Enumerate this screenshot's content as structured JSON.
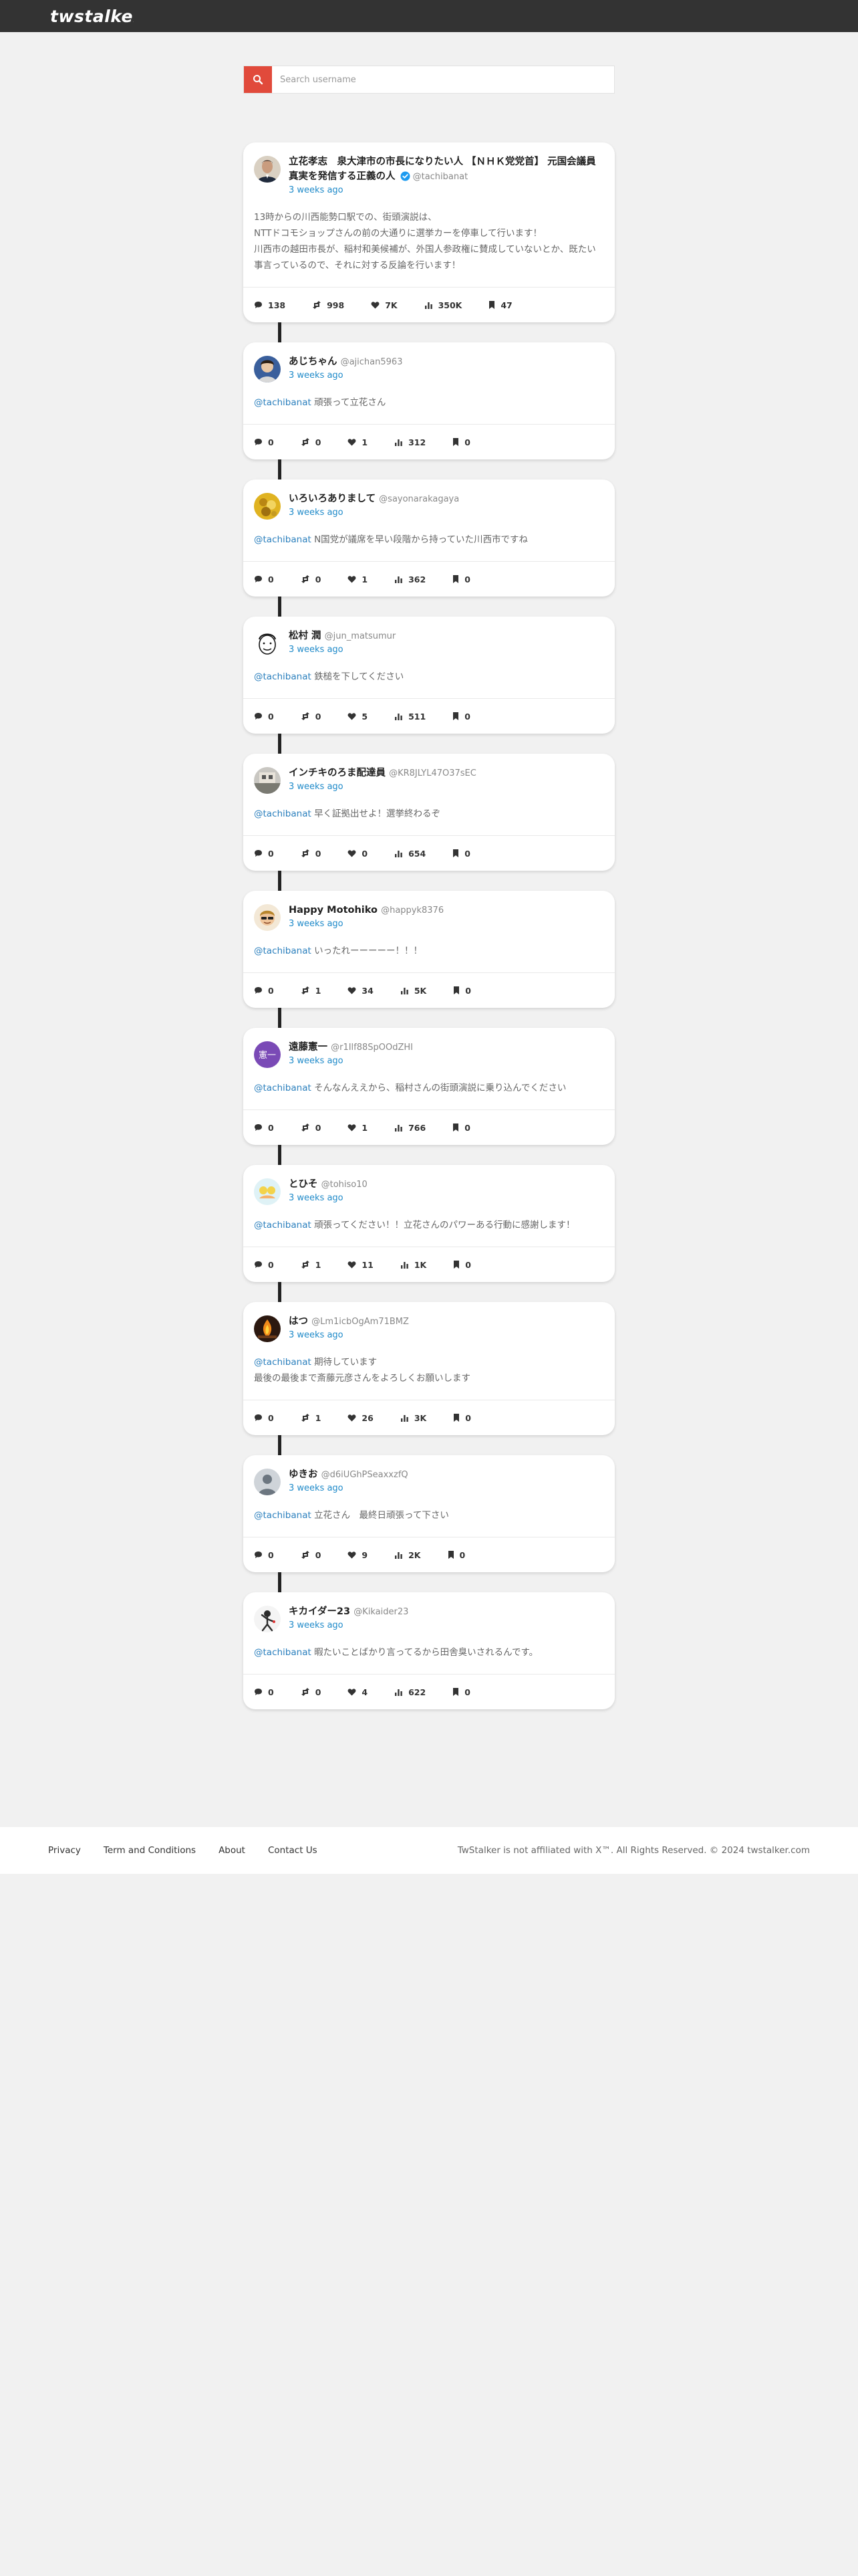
{
  "brand": {
    "name": "twstalker",
    "accent": "#e14a3b"
  },
  "search": {
    "placeholder": "Search username",
    "value": ""
  },
  "posts": [
    {
      "name": "立花孝志　泉大津市の市長になりたい人 【ＮＨＫ党党首】 元国会議員　真実を発信する正義の人",
      "handle": "@tachibanat",
      "verified": true,
      "time": "3 weeks ago",
      "avatar": "avatar-tachibana",
      "mention": "",
      "lines": [
        "13時からの川西能勢口駅での、街頭演説は、",
        "NTTドコモショップさんの前の大通りに選挙カーを停車して行います！",
        "川西市の越田市長が、稲村和美候補が、外国人参政権に賛成していないとか、既たい事言っているので、それに対する反論を行います！"
      ],
      "stats": {
        "replies": "138",
        "retweets": "998",
        "likes": "7K",
        "views": "350K",
        "bookmarks": "47"
      }
    },
    {
      "name": "あじちゃん",
      "handle": "@ajichan5963",
      "time": "3 weeks ago",
      "avatar": "avatar-ajichan",
      "mention": "@tachibanat",
      "lines": [
        "頑張って立花さん"
      ],
      "stats": {
        "replies": "0",
        "retweets": "0",
        "likes": "1",
        "views": "312",
        "bookmarks": "0"
      }
    },
    {
      "name": "いろいろありまして",
      "handle": "@sayonarakagaya",
      "time": "3 weeks ago",
      "avatar": "avatar-iroiro",
      "mention": "@tachibanat",
      "lines": [
        "N国党が議席を早い段階から持っていた川西市ですね"
      ],
      "stats": {
        "replies": "0",
        "retweets": "0",
        "likes": "1",
        "views": "362",
        "bookmarks": "0"
      }
    },
    {
      "name": "松村 潤",
      "handle": "@jun_matsumur",
      "time": "3 weeks ago",
      "avatar": "avatar-matsumura",
      "mention": "@tachibanat",
      "lines": [
        "鉄槌を下してください"
      ],
      "stats": {
        "replies": "0",
        "retweets": "0",
        "likes": "5",
        "views": "511",
        "bookmarks": "0"
      }
    },
    {
      "name": "インチキのろま配達員",
      "handle": "@KR8JLYL47O37sEC",
      "time": "3 weeks ago",
      "avatar": "avatar-inchiki",
      "mention": "@tachibanat",
      "lines": [
        "早く証拠出せよ！選挙終わるぞ"
      ],
      "stats": {
        "replies": "0",
        "retweets": "0",
        "likes": "0",
        "views": "654",
        "bookmarks": "0"
      }
    },
    {
      "name": "Happy Motohiko",
      "handle": "@happyk8376",
      "time": "3 weeks ago",
      "avatar": "avatar-happy",
      "mention": "@tachibanat",
      "lines": [
        "いったれーーーーー！！！"
      ],
      "stats": {
        "replies": "0",
        "retweets": "1",
        "likes": "34",
        "views": "5K",
        "bookmarks": "0"
      }
    },
    {
      "name": "遠藤憲一",
      "handle": "@r1Ilf88SpOOdZHI",
      "time": "3 weeks ago",
      "avatar": "avatar-endo",
      "mention": "@tachibanat",
      "lines": [
        "そんなんええから、稲村さんの街頭演説に乗り込んでください"
      ],
      "stats": {
        "replies": "0",
        "retweets": "0",
        "likes": "1",
        "views": "766",
        "bookmarks": "0"
      }
    },
    {
      "name": "とひそ",
      "handle": "@tohiso10",
      "time": "3 weeks ago",
      "avatar": "avatar-tohiso",
      "mention": "@tachibanat",
      "lines": [
        "頑張ってください！！立花さんのパワーある行動に感謝します！"
      ],
      "stats": {
        "replies": "0",
        "retweets": "1",
        "likes": "11",
        "views": "1K",
        "bookmarks": "0"
      }
    },
    {
      "name": "はつ",
      "handle": "@Lm1icbOgAm71BMZ",
      "time": "3 weeks ago",
      "avatar": "avatar-hatsu",
      "mention": "@tachibanat",
      "lines": [
        "期待しています",
        "最後の最後まで斎藤元彦さんをよろしくお願いします"
      ],
      "stats": {
        "replies": "0",
        "retweets": "1",
        "likes": "26",
        "views": "3K",
        "bookmarks": "0"
      }
    },
    {
      "name": "ゆきお",
      "handle": "@d6iUGhPSeaxxzfQ",
      "time": "3 weeks ago",
      "avatar": "avatar-yukio",
      "mention": "@tachibanat",
      "lines": [
        "立花さん　最終日頑張って下さい"
      ],
      "stats": {
        "replies": "0",
        "retweets": "0",
        "likes": "9",
        "views": "2K",
        "bookmarks": "0"
      }
    },
    {
      "name": "キカイダー23",
      "handle": "@Kikaider23",
      "time": "3 weeks ago",
      "avatar": "avatar-kikaider",
      "mention": "@tachibanat",
      "lines": [
        "暇たいことばかり言ってるから田舎臭いされるんです。"
      ],
      "stats": {
        "replies": "0",
        "retweets": "0",
        "likes": "4",
        "views": "622",
        "bookmarks": "0"
      }
    }
  ],
  "footer": {
    "links": [
      "Privacy",
      "Term and Conditions",
      "About",
      "Contact Us"
    ],
    "copyright": "TwStalker is not affiliated with X™. All Rights Reserved. © 2024 twstalker.com"
  },
  "colors": {
    "link": "#2a7fbd",
    "time": "#1f8ac9",
    "topbar": "#333333",
    "page_bg": "#f1f1f1"
  }
}
